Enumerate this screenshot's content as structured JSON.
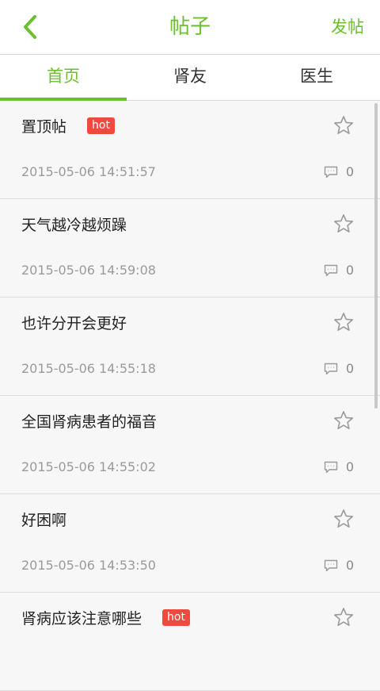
{
  "header": {
    "title": "帖子",
    "post_label": "发帖",
    "accent_color": "#6cbf2e"
  },
  "tabs": [
    {
      "label": "首页",
      "active": true
    },
    {
      "label": "肾友",
      "active": false
    },
    {
      "label": "医生",
      "active": false
    }
  ],
  "posts": [
    {
      "title": "置顶帖",
      "hot": "hot",
      "time": "2015-05-06 14:51:57",
      "comments": "0"
    },
    {
      "title": "天气越冷越烦躁",
      "hot": "",
      "time": "2015-05-06 14:59:08",
      "comments": "0"
    },
    {
      "title": "也许分开会更好",
      "hot": "",
      "time": "2015-05-06 14:55:18",
      "comments": "0"
    },
    {
      "title": "全国肾病患者的福音",
      "hot": "",
      "time": "2015-05-06 14:55:02",
      "comments": "0"
    },
    {
      "title": "好困啊",
      "hot": "",
      "time": "2015-05-06 14:53:50",
      "comments": "0"
    },
    {
      "title": "肾病应该注意哪些",
      "hot": "hot",
      "time": "",
      "comments": ""
    }
  ],
  "icons": {
    "back": "chevron-left-icon",
    "favorite": "star-outline-icon",
    "comment": "comment-icon"
  }
}
